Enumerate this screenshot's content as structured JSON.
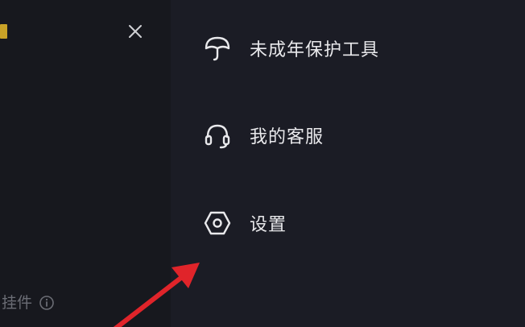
{
  "left_panel": {
    "widget_label": "挂件"
  },
  "menu": {
    "items": [
      {
        "label": "未成年保护工具",
        "icon": "umbrella-icon"
      },
      {
        "label": "我的客服",
        "icon": "headset-icon"
      },
      {
        "label": "设置",
        "icon": "settings-hexagon-icon"
      }
    ]
  },
  "colors": {
    "left_panel_bg": "#17181e",
    "right_panel_bg": "#1b1c25",
    "menu_text": "#e9e9ec",
    "annotation_arrow": "#e0242a",
    "accent_yellow": "#c9a227"
  }
}
